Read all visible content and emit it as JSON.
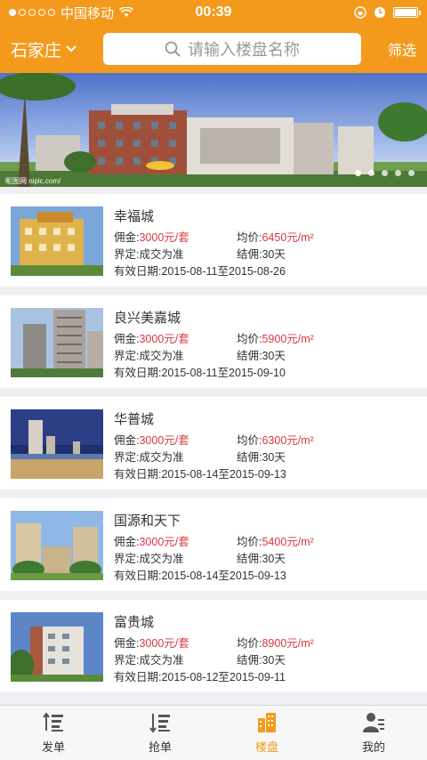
{
  "status_bar": {
    "carrier": "中国移动",
    "time": "00:39"
  },
  "header": {
    "city": "石家庄",
    "search_placeholder": "请输入楼盘名称",
    "filter_label": "筛选"
  },
  "banner": {
    "watermark": "昵图网 nipic.com/"
  },
  "labels": {
    "commission": "佣金:",
    "avg_price": "均价:",
    "define": "界定:",
    "settle": "结佣:",
    "valid": "有效日期: "
  },
  "listings": [
    {
      "name": "幸福城",
      "commission": "3000元/套",
      "price": "6450元/m²",
      "define": "成交为准",
      "settle": "30天",
      "valid": "2015-08-11至2015-08-26"
    },
    {
      "name": "良兴美嘉城",
      "commission": "3000元/套",
      "price": "5900元/m²",
      "define": "成交为准",
      "settle": "30天",
      "valid": "2015-08-11至2015-09-10"
    },
    {
      "name": "华普城",
      "commission": "3000元/套",
      "price": "6300元/m²",
      "define": "成交为准",
      "settle": "30天",
      "valid": "2015-08-14至2015-09-13"
    },
    {
      "name": "国源和天下",
      "commission": "3000元/套",
      "price": "5400元/m²",
      "define": "成交为准",
      "settle": "30天",
      "valid": "2015-08-14至2015-09-13"
    },
    {
      "name": "富贵城",
      "commission": "3000元/套",
      "price": "8900元/m²",
      "define": "成交为准",
      "settle": "30天",
      "valid": "2015-08-12至2015-09-11"
    }
  ],
  "tabs": [
    {
      "label": "发单",
      "icon": "sort-ascending-icon"
    },
    {
      "label": "抢单",
      "icon": "sort-descending-icon"
    },
    {
      "label": "楼盘",
      "icon": "building-icon"
    },
    {
      "label": "我的",
      "icon": "user-list-icon"
    }
  ],
  "colors": {
    "accent": "#f39a1d",
    "price_red": "#d9383e"
  }
}
